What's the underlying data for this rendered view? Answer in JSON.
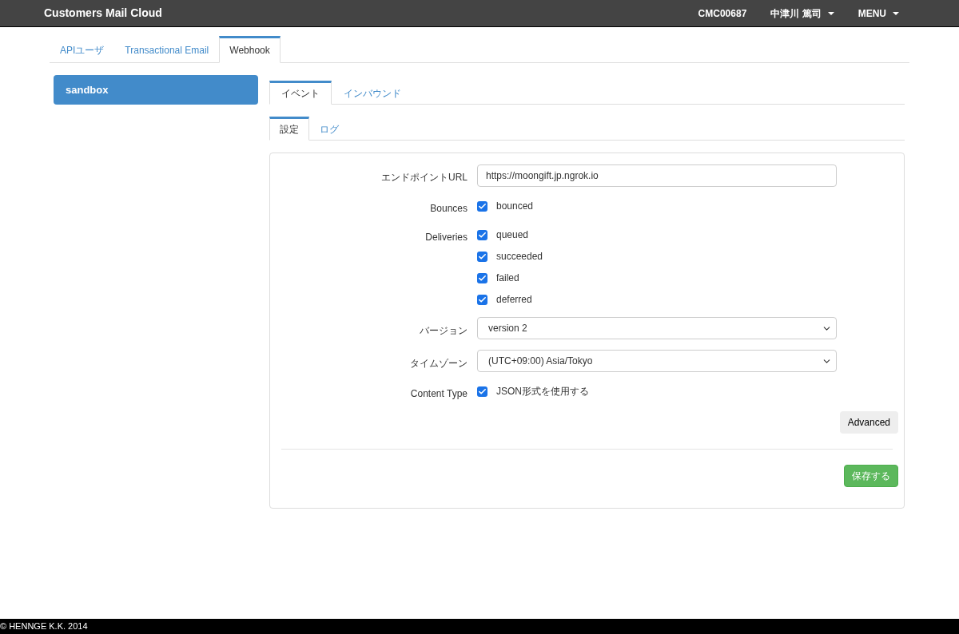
{
  "navbar": {
    "brand": "Customers Mail Cloud",
    "account": "CMC00687",
    "user": "中津川 篤司",
    "menu": "MENU"
  },
  "top_tabs": [
    {
      "label": "APIユーザ",
      "selected": false
    },
    {
      "label": "Transactional Email",
      "selected": false
    },
    {
      "label": "Webhook",
      "selected": true
    }
  ],
  "sidebar": {
    "items": [
      {
        "label": "sandbox",
        "selected": true
      }
    ]
  },
  "event_tabs": [
    {
      "label": "イベント",
      "selected": true
    },
    {
      "label": "インバウンド",
      "selected": false
    }
  ],
  "sub_tabs": [
    {
      "label": "設定",
      "selected": true
    },
    {
      "label": "ログ",
      "selected": false
    }
  ],
  "form": {
    "rows": [
      {
        "kind": "text",
        "label": "エンドポイントURL",
        "value": "https://moongift.jp.ngrok.io"
      },
      {
        "kind": "checkboxes",
        "label": "Bounces",
        "options": [
          {
            "label": "bounced",
            "checked": true
          }
        ]
      },
      {
        "kind": "checkboxes",
        "label": "Deliveries",
        "options": [
          {
            "label": "queued",
            "checked": true
          },
          {
            "label": "succeeded",
            "checked": true
          },
          {
            "label": "failed",
            "checked": true
          },
          {
            "label": "deferred",
            "checked": true
          }
        ]
      },
      {
        "kind": "select",
        "label": "バージョン",
        "value": "version 2"
      },
      {
        "kind": "select",
        "label": "タイムゾーン",
        "value": "(UTC+09:00) Asia/Tokyo"
      },
      {
        "kind": "checkboxes",
        "label": "Content Type",
        "options": [
          {
            "label": "JSON形式を使用する",
            "checked": true
          }
        ]
      }
    ],
    "advanced_button": "Advanced",
    "save_button": "保存する"
  },
  "footer": "© HENNGE K.K. 2014"
}
